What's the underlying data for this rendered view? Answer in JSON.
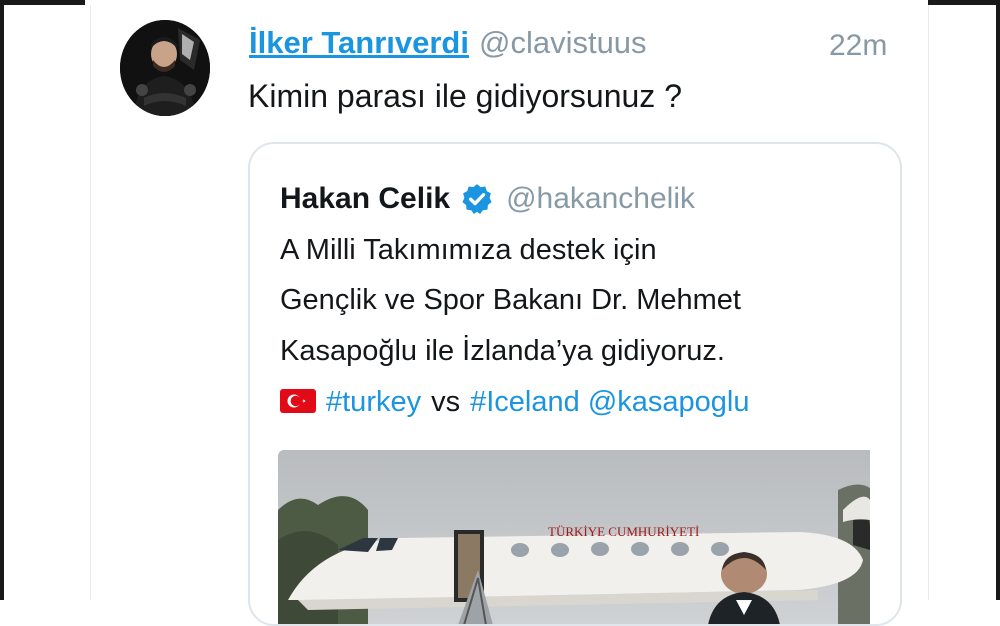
{
  "tweet": {
    "display_name": "İlker Tanrıverdi",
    "handle": "@clavistuus",
    "timestamp": "22m",
    "text": "Kimin parası ile gidiyorsunuz ?",
    "avatar_icon": "profile-photo"
  },
  "quoted_tweet": {
    "display_name": "Hakan Celik",
    "verified_icon": "verified-badge-icon",
    "handle": "@hakanchelik",
    "lines": [
      "A Milli Takımımıza destek için",
      "Gençlik ve Spor Bakanı Dr. Mehmet",
      "Kasapoğlu ile  İzlanda’ya gidiyoruz."
    ],
    "flag_icon": "turkey-flag-icon",
    "hashtag_1": "#turkey",
    "vs_text": "vs",
    "hashtag_2": "#Iceland",
    "mention": "@kasapoglu",
    "media": {
      "plane_text": "TÜRKİYE CUMHURİYETİ"
    }
  },
  "colors": {
    "link_blue": "#1b95e0",
    "handle_gray": "#8899a6",
    "text_dark": "#14171a",
    "border": "#dfe5ea",
    "flag_red": "#e30a17"
  }
}
